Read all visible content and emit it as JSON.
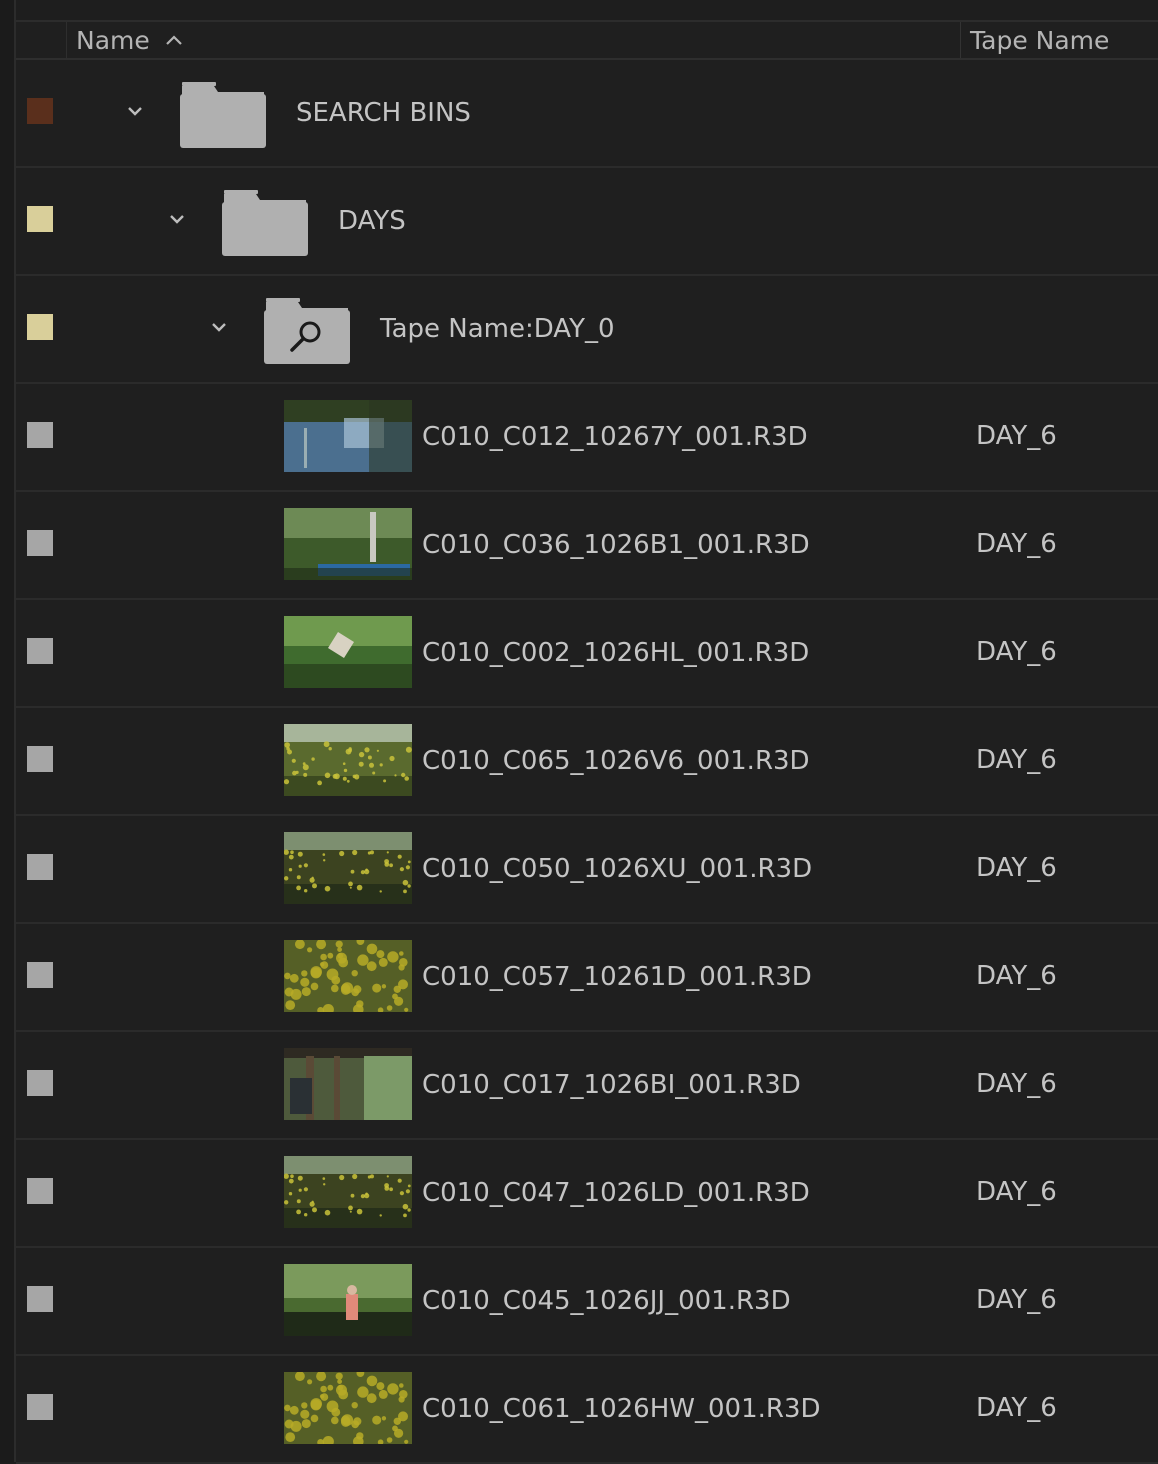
{
  "columns": {
    "name": "Name",
    "tape_name": "Tape Name"
  },
  "colors": {
    "label_brown": "#5a2f1c",
    "label_tan": "#d9cf9a",
    "label_gray": "#a6a6a6",
    "folder_gray": "#b0b0b0",
    "text": "#c4c4c4"
  },
  "bins": [
    {
      "name": "SEARCH BINS",
      "label_color": "#5a2f1c",
      "icon": "folder-icon",
      "expanded": true
    },
    {
      "name": "DAYS",
      "label_color": "#d9cf9a",
      "icon": "folder-icon",
      "expanded": true
    },
    {
      "name": "Tape Name:DAY_0",
      "label_color": "#d9cf9a",
      "icon": "search-bin-icon",
      "expanded": true
    }
  ],
  "clips": [
    {
      "name": "C010_C012_10267Y_001.R3D",
      "tape": "DAY_6",
      "thumb": "water-reflection"
    },
    {
      "name": "C010_C036_1026B1_001.R3D",
      "tape": "DAY_6",
      "thumb": "forest-boat"
    },
    {
      "name": "C010_C002_1026HL_001.R3D",
      "tape": "DAY_6",
      "thumb": "foliage-sign"
    },
    {
      "name": "C010_C065_1026V6_001.R3D",
      "tape": "DAY_6",
      "thumb": "meadow"
    },
    {
      "name": "C010_C050_1026XU_001.R3D",
      "tape": "DAY_6",
      "thumb": "meadow-dark"
    },
    {
      "name": "C010_C057_10261D_001.R3D",
      "tape": "DAY_6",
      "thumb": "yellow-flowers"
    },
    {
      "name": "C010_C017_1026BI_001.R3D",
      "tape": "DAY_6",
      "thumb": "porch"
    },
    {
      "name": "C010_C047_1026LD_001.R3D",
      "tape": "DAY_6",
      "thumb": "meadow-dark"
    },
    {
      "name": "C010_C045_1026JJ_001.R3D",
      "tape": "DAY_6",
      "thumb": "person-water"
    },
    {
      "name": "C010_C061_1026HW_001.R3D",
      "tape": "DAY_6",
      "thumb": "yellow-flowers"
    }
  ]
}
